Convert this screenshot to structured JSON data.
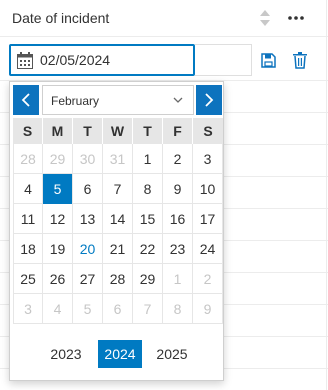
{
  "field": {
    "title": "Date of incident",
    "date_value": "02/05/2024"
  },
  "icons": {
    "sort": "sort-arrows-icon",
    "more": "more-dots-icon",
    "calendar": "calendar-icon",
    "save": "save-icon",
    "delete": "trash-icon",
    "prev": "chevron-left-icon",
    "next": "chevron-right-icon",
    "dropdown": "chevron-down-icon"
  },
  "colors": {
    "accent": "#007ac2",
    "nav": "#0d73be",
    "muted": "#c6c6c6"
  },
  "calendar": {
    "month_label": "February",
    "weekdays": [
      "S",
      "M",
      "T",
      "W",
      "T",
      "F",
      "S"
    ],
    "weeks": [
      [
        {
          "d": "28",
          "o": true
        },
        {
          "d": "29",
          "o": true
        },
        {
          "d": "30",
          "o": true
        },
        {
          "d": "31",
          "o": true
        },
        {
          "d": "1"
        },
        {
          "d": "2"
        },
        {
          "d": "3"
        }
      ],
      [
        {
          "d": "4"
        },
        {
          "d": "5",
          "sel": true
        },
        {
          "d": "6"
        },
        {
          "d": "7"
        },
        {
          "d": "8"
        },
        {
          "d": "9"
        },
        {
          "d": "10"
        }
      ],
      [
        {
          "d": "11"
        },
        {
          "d": "12"
        },
        {
          "d": "13"
        },
        {
          "d": "14"
        },
        {
          "d": "15"
        },
        {
          "d": "16"
        },
        {
          "d": "17"
        }
      ],
      [
        {
          "d": "18"
        },
        {
          "d": "19"
        },
        {
          "d": "20",
          "today": true
        },
        {
          "d": "21"
        },
        {
          "d": "22"
        },
        {
          "d": "23"
        },
        {
          "d": "24"
        }
      ],
      [
        {
          "d": "25"
        },
        {
          "d": "26"
        },
        {
          "d": "27"
        },
        {
          "d": "28"
        },
        {
          "d": "29"
        },
        {
          "d": "1",
          "o": true
        },
        {
          "d": "2",
          "o": true
        }
      ],
      [
        {
          "d": "3",
          "o": true
        },
        {
          "d": "4",
          "o": true
        },
        {
          "d": "5",
          "o": true
        },
        {
          "d": "6",
          "o": true
        },
        {
          "d": "7",
          "o": true
        },
        {
          "d": "8",
          "o": true
        },
        {
          "d": "9",
          "o": true
        }
      ]
    ],
    "years": [
      {
        "label": "2023",
        "selected": false
      },
      {
        "label": "2024",
        "selected": true
      },
      {
        "label": "2025",
        "selected": false
      }
    ]
  }
}
